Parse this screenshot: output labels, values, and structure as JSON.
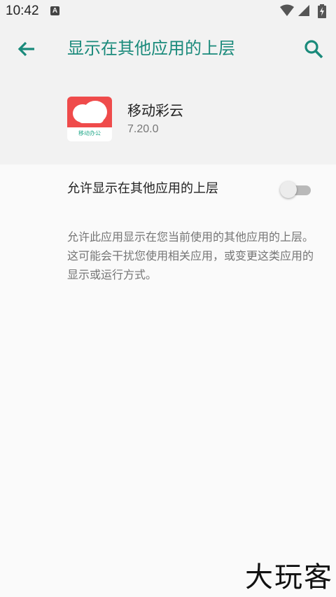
{
  "status_bar": {
    "time": "10:42",
    "notification_glyph": "A",
    "icons": [
      "wifi-icon",
      "signal-icon",
      "battery-charging-icon"
    ]
  },
  "app_bar": {
    "title": "显示在其他应用的上层",
    "back_icon": "arrow-back-icon",
    "search_icon": "search-icon",
    "accent_color": "#1a8a7b"
  },
  "app_info": {
    "name": "移动彩云",
    "version": "7.20.0",
    "icon_brand_text": "移动办公",
    "icon_color": "#ef4b4b"
  },
  "permission": {
    "label": "允许显示在其他应用的上层",
    "toggle_state": "off",
    "description": "允许此应用显示在您当前使用的其他应用的上层。这可能会干扰您使用相关应用，或变更这类应用的显示或运行方式。"
  },
  "watermark": {
    "text": "大玩客"
  }
}
